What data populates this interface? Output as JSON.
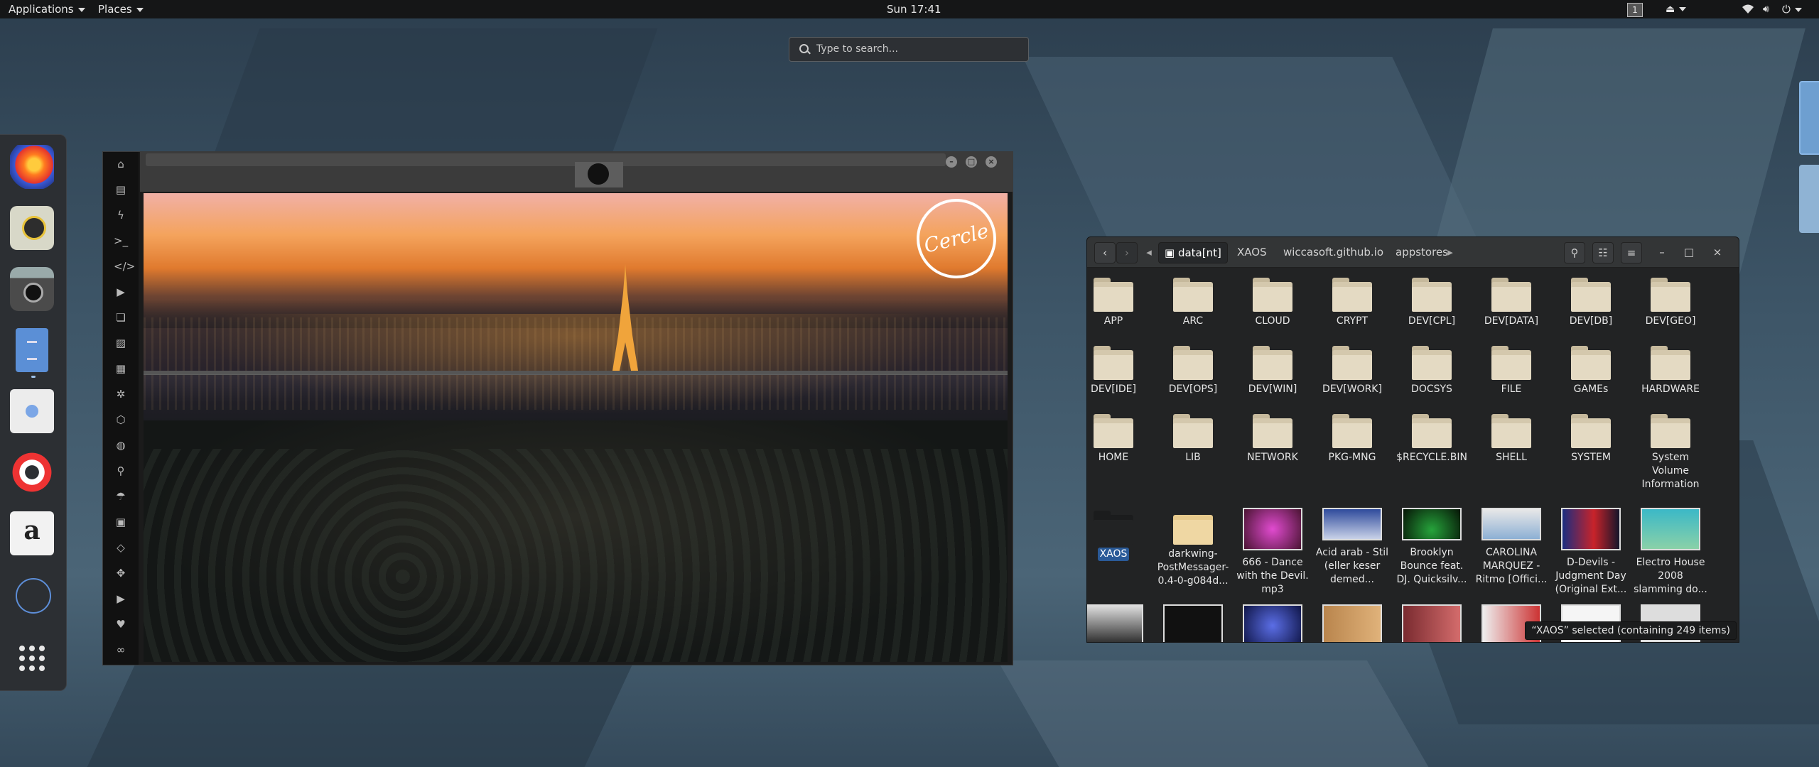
{
  "topbar": {
    "applications": "Applications",
    "places": "Places",
    "clock": "Sun 17:41",
    "workspace": "1"
  },
  "search": {
    "placeholder": "Type to search..."
  },
  "dock": {
    "apps": [
      {
        "name": "firefox-icon"
      },
      {
        "name": "speaker-icon"
      },
      {
        "name": "camera-icon"
      },
      {
        "name": "files-cabinet-icon"
      },
      {
        "name": "calendar-icon"
      },
      {
        "name": "help-lifebuoy-icon"
      },
      {
        "name": "amazon-icon"
      },
      {
        "name": "workspace-dots-icon"
      }
    ],
    "show_apps": "show-applications-icon"
  },
  "media": {
    "logo_text": "Cercle",
    "sidebar_icons": [
      "home-icon",
      "document-icon",
      "bolt-icon",
      "terminal-icon",
      "code-icon",
      "play-icon",
      "image-stack-icon",
      "image-icon",
      "newspaper-icon",
      "settings-icon",
      "hexagon-icon",
      "globe-icon",
      "search-icon",
      "umbrella-icon",
      "contact-icon",
      "tags-icon",
      "expand-icon",
      "youtube-icon",
      "heart-icon",
      "link-icon"
    ]
  },
  "filemanager": {
    "breadcrumbs": [
      "data[nt]",
      "XAOS",
      "wiccasoft.github.io",
      "appstores"
    ],
    "items": [
      {
        "label": "APP"
      },
      {
        "label": "ARC"
      },
      {
        "label": "CLOUD"
      },
      {
        "label": "CRYPT"
      },
      {
        "label": "DEV[CPL]"
      },
      {
        "label": "DEV[DATA]"
      },
      {
        "label": "DEV[DB]"
      },
      {
        "label": "DEV[GEO]"
      },
      {
        "label": "DEV[IDE]"
      },
      {
        "label": "DEV[OPS]"
      },
      {
        "label": "DEV[WIN]"
      },
      {
        "label": "DEV[WORK]"
      },
      {
        "label": "DOCSYS"
      },
      {
        "label": "FILE"
      },
      {
        "label": "GAMEs"
      },
      {
        "label": "HARDWARE"
      },
      {
        "label": "HOME"
      },
      {
        "label": "LIB"
      },
      {
        "label": "NETWORK"
      },
      {
        "label": "PKG-MNG"
      },
      {
        "label": "$RECYCLE.BIN"
      },
      {
        "label": "SHELL"
      },
      {
        "label": "SYSTEM"
      },
      {
        "label": "System Volume Information"
      },
      {
        "label": "XAOS"
      },
      {
        "label": "darkwing-PostMessager-0.4-0-g084d..."
      },
      {
        "label": "666 - Dance with the Devil. mp3"
      },
      {
        "label": "Acid arab - Stil (eller keser demed..."
      },
      {
        "label": "Brooklyn Bounce feat. DJ. Quicksilv..."
      },
      {
        "label": "CAROLINA MARQUEZ - Ritmo [Offici..."
      },
      {
        "label": "D-Devils - Judgment Day (Original Ext..."
      },
      {
        "label": "Electro House 2008 slamming do..."
      }
    ],
    "status": "“XAOS” selected  (containing 249 items)"
  }
}
